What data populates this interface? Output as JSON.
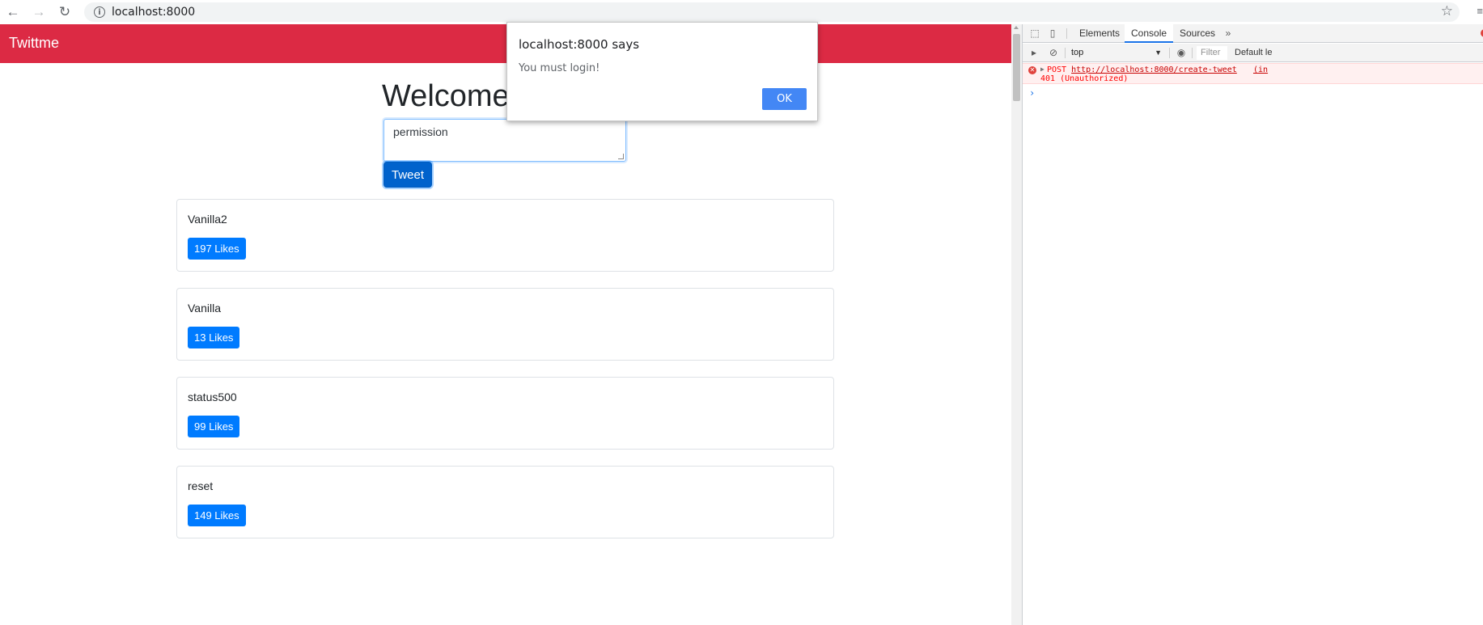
{
  "browser": {
    "url": "localhost:8000",
    "back_icon": "←",
    "forward_icon": "→",
    "reload_icon": "↻",
    "info_icon": "i",
    "star_icon": "☆",
    "menu_icon": "≡"
  },
  "app": {
    "brand": "Twittme",
    "title": "Welcome t",
    "tweet_input_value": "permission",
    "tweet_button_label": "Tweet",
    "accent_color": "#dc2a44",
    "button_color": "#007bff"
  },
  "tweets": [
    {
      "text": "Vanilla2",
      "likes_label": "197 Likes"
    },
    {
      "text": "Vanilla",
      "likes_label": "13 Likes"
    },
    {
      "text": "status500",
      "likes_label": "99 Likes"
    },
    {
      "text": "reset",
      "likes_label": "149 Likes"
    }
  ],
  "alert": {
    "title": "localhost:8000 says",
    "message": "You must login!",
    "ok_label": "OK"
  },
  "devtools": {
    "tabs": [
      "Elements",
      "Console",
      "Sources"
    ],
    "selected_tab": "Console",
    "more_tabs_icon": "»",
    "context": "top",
    "filter_placeholder": "Filter",
    "levels_label": "Default le",
    "error": {
      "method": "POST",
      "url": "http://localhost:8000/create-tweet",
      "status": "401 (Unauthorized)",
      "source": "(in"
    },
    "prompt": "›"
  }
}
